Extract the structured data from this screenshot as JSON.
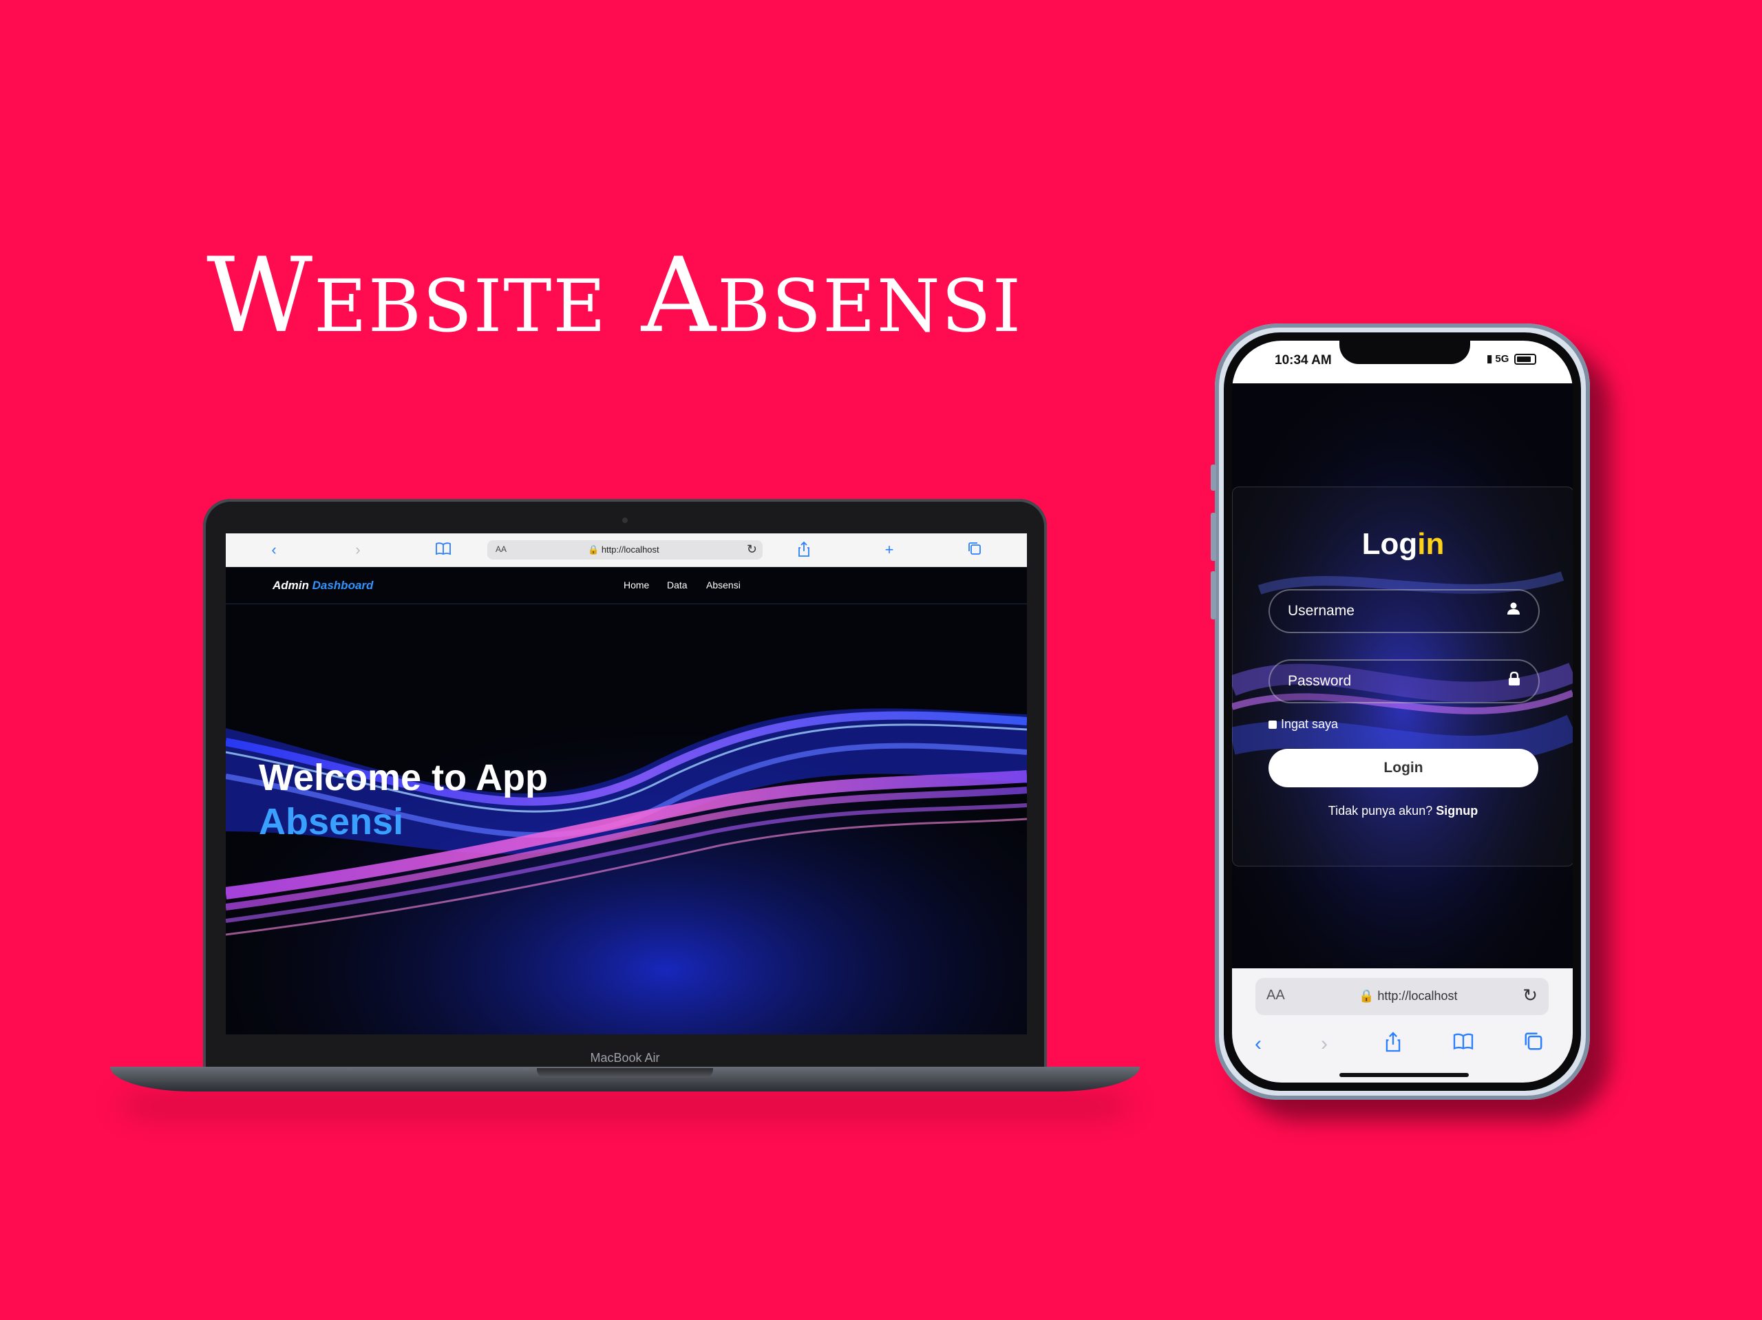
{
  "title": "Website Absensi",
  "laptop": {
    "model_label": "MacBook Air",
    "browser": {
      "text_size_label": "AA",
      "url": "http://localhost",
      "icons": [
        "back-icon",
        "forward-icon",
        "bookmarks-icon",
        "reload-icon",
        "share-icon",
        "new-tab-icon",
        "tabs-icon"
      ]
    },
    "nav": {
      "brand_main": "Admin ",
      "brand_accent": "Dashboard",
      "items": [
        "Home",
        "Data",
        "Absensi"
      ]
    },
    "hero": {
      "line1": "Welcome to App",
      "line2": "Absensi"
    }
  },
  "phone": {
    "status": {
      "time": "10:34 AM",
      "network": "5G"
    },
    "login": {
      "title_main": "Log",
      "title_accent": "in",
      "username_placeholder": "Username",
      "password_placeholder": "Password",
      "remember_label": "Ingat saya",
      "button_label": "Login",
      "signup_prompt": "Tidak punya akun? ",
      "signup_link": "Signup"
    },
    "browser": {
      "text_size_label": "AA",
      "url": "http://localhost"
    }
  },
  "colors": {
    "background": "#ff0c50",
    "accent_blue": "#2f94ff",
    "accent_yellow": "#ffd21a",
    "hero_dark": "#04050b"
  }
}
